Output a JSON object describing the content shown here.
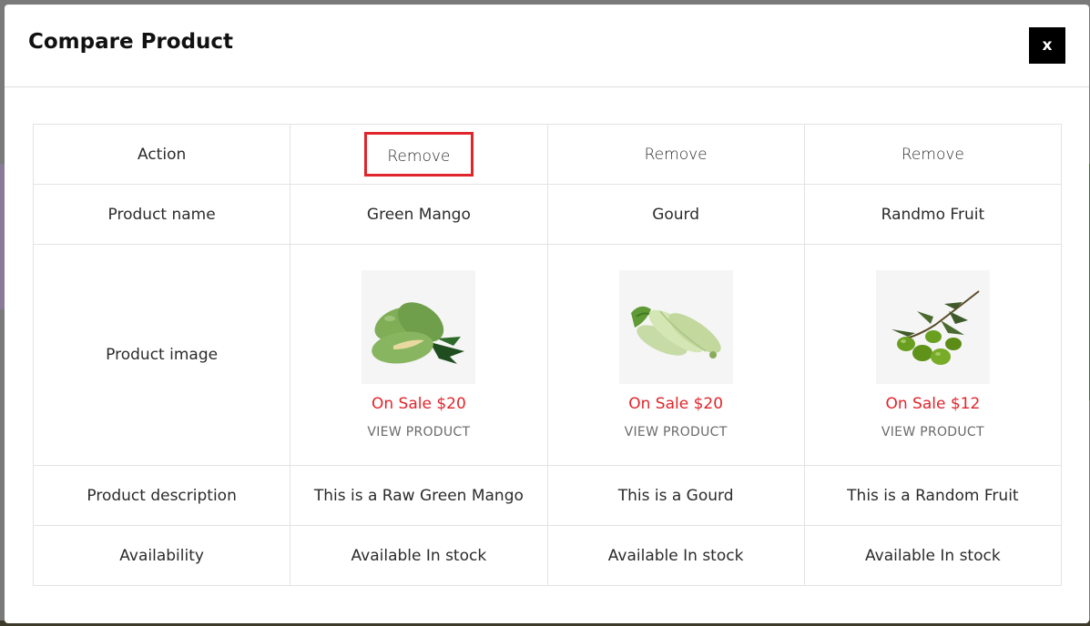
{
  "modal": {
    "title": "Compare Product",
    "close_label": "x"
  },
  "table": {
    "row_labels": {
      "action": "Action",
      "name": "Product name",
      "image": "Product image",
      "description": "Product description",
      "availability": "Availability"
    },
    "products": [
      {
        "remove_label": "Remove",
        "name": "Green Mango",
        "image_icon": "green-mango-image",
        "sale_price": "On Sale $20",
        "view_label": "VIEW PRODUCT",
        "description": "This is a Raw Green Mango",
        "availability": "Available In stock"
      },
      {
        "remove_label": "Remove",
        "name": "Gourd",
        "image_icon": "gourd-image",
        "sale_price": "On Sale $20",
        "view_label": "VIEW PRODUCT",
        "description": "This is a Gourd",
        "availability": "Available In stock"
      },
      {
        "remove_label": "Remove",
        "name": "Randmo Fruit",
        "image_icon": "olive-branch-image",
        "sale_price": "On Sale $12",
        "view_label": "VIEW PRODUCT",
        "description": "This is a Random Fruit",
        "availability": "Available In stock"
      }
    ]
  },
  "colors": {
    "sale": "#e0252b",
    "highlight_border": "#e0252b",
    "close_bg": "#000000"
  }
}
